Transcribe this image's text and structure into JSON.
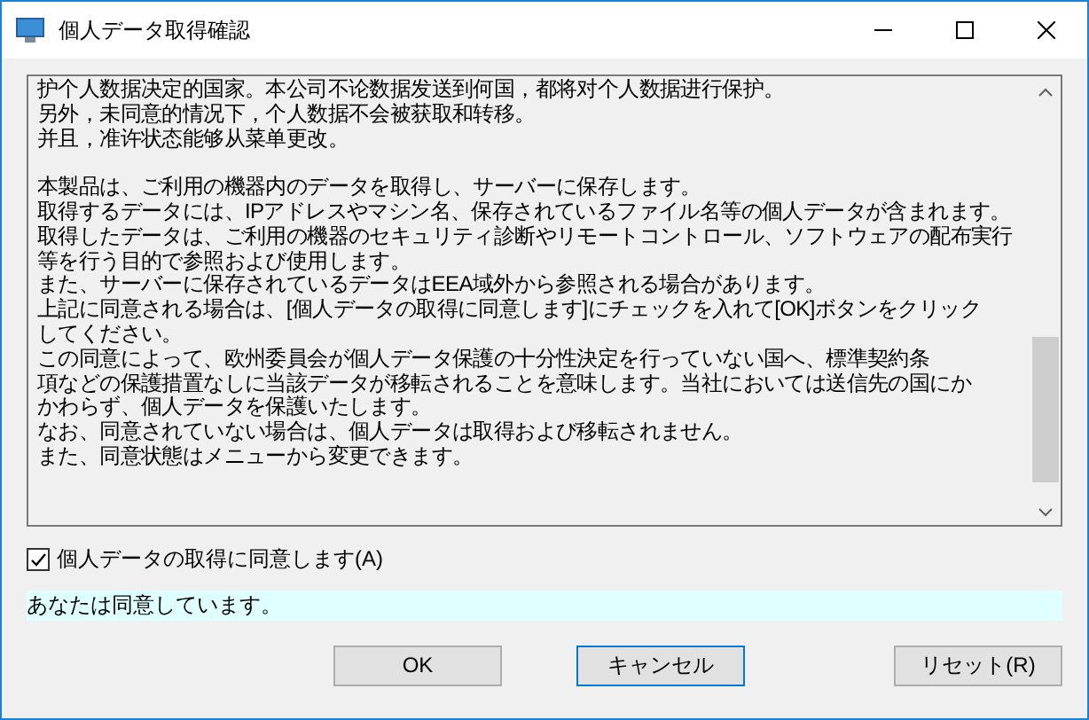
{
  "window": {
    "title": "個人データ取得確認"
  },
  "notice": {
    "paragraphs": [
      [
        "护个人数据决定的国家。本公司不论数据发送到何国，都将对个人数据进行保护。",
        "另外，未同意的情况下，个人数据不会被获取和转移。",
        "并且，准许状态能够从菜单更改。"
      ],
      [
        "本製品は、ご利用の機器内のデータを取得し、サーバーに保存します。",
        "取得するデータには、IPアドレスやマシン名、保存されているファイル名等の個人データが含まれます。",
        "取得したデータは、ご利用の機器のセキュリティ診断やリモートコントロール、ソフトウェアの配布実行",
        "等を行う目的で参照および使用します。",
        "また、サーバーに保存されているデータはEEA域外から参照される場合があります。",
        "上記に同意される場合は、[個人データの取得に同意します]にチェックを入れて[OK]ボタンをクリック",
        "してください。",
        "この同意によって、欧州委員会が個人データ保護の十分性決定を行っていない国へ、標準契約条",
        "項などの保護措置なしに当該データが移転されることを意味します。当社においては送信先の国にか",
        "かわらず、個人データを保護いたします。",
        "なお、同意されていない場合は、個人データは取得および移転されません。",
        "また、同意状態はメニューから変更できます。"
      ]
    ]
  },
  "consent": {
    "label": "個人データの取得に同意します(A)",
    "checked": true
  },
  "status": "あなたは同意しています。",
  "buttons": [
    {
      "label": "OK",
      "focused": false
    },
    {
      "label": "キャンセル",
      "focused": true
    },
    {
      "label": "リセット(R)",
      "focused": false
    }
  ]
}
